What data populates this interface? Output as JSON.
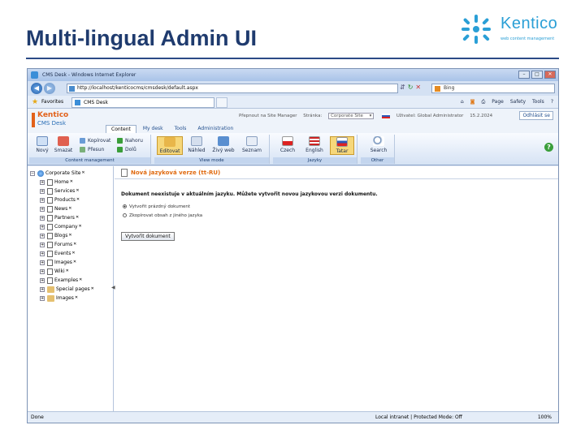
{
  "slide": {
    "title": "Multi-lingual Admin UI",
    "logo_name": "Kentico",
    "logo_tagline": "web content management"
  },
  "browser": {
    "window_title": "CMS Desk - Windows Internet Explorer",
    "address": "http://localhost/kenticocms/cmsdesk/default.aspx",
    "search_placeholder": "Bing",
    "favorites_label": "Favorites",
    "tab_label": "CMS Desk",
    "commands": [
      "Page",
      "Safety",
      "Tools"
    ],
    "status_left": "Done",
    "status_zone": "Local intranet | Protected Mode: Off",
    "zoom": "100%"
  },
  "cms": {
    "logo_kentico": "Kentico",
    "logo_desk": "CMS Desk",
    "header": {
      "switch_site_label": "Přepnout na Site Manager",
      "site_label": "Stránka:",
      "site_value": "Corporate Site",
      "user_label": "Uživatel: Global Administrator",
      "date": "15.2.2024",
      "logout": "Odhlásit se"
    },
    "tabs": [
      "Content",
      "My desk",
      "Tools",
      "Administration"
    ],
    "ribbon": {
      "content_management": {
        "label": "Content management",
        "new": "Nový",
        "delete": "Smazat",
        "copy": "Kopírovat",
        "move": "Přesun",
        "up": "Nahoru",
        "down": "Dolů"
      },
      "view_mode": {
        "label": "View mode",
        "edit": "Editovat",
        "preview": "Náhled",
        "live": "Živý web",
        "list": "Seznam"
      },
      "languages": {
        "label": "Jazyky",
        "czech": "Czech",
        "english": "English",
        "russian": "Tatar"
      },
      "other": {
        "label": "Other",
        "search": "Search"
      }
    },
    "tree": [
      {
        "label": "Corporate Site",
        "icon": "globe-icon"
      },
      {
        "label": "Home",
        "icon": "doc-icon"
      },
      {
        "label": "Services",
        "icon": "doc-icon"
      },
      {
        "label": "Products",
        "icon": "doc-icon"
      },
      {
        "label": "News",
        "icon": "doc-icon"
      },
      {
        "label": "Partners",
        "icon": "doc-icon"
      },
      {
        "label": "Company",
        "icon": "doc-icon"
      },
      {
        "label": "Blogs",
        "icon": "doc-icon"
      },
      {
        "label": "Forums",
        "icon": "doc-icon"
      },
      {
        "label": "Events",
        "icon": "doc-icon"
      },
      {
        "label": "Images",
        "icon": "doc-icon"
      },
      {
        "label": "Wiki",
        "icon": "doc-icon"
      },
      {
        "label": "Examples",
        "icon": "doc-icon"
      },
      {
        "label": "Special pages",
        "icon": "folder-icon"
      },
      {
        "label": "Images",
        "icon": "folder-icon"
      }
    ],
    "pane_title": "Nová jazyková verze (tt-RU)",
    "message": "Dokument neexistuje v aktuálním jazyku. Můžete vytvořit novou jazykovou verzi dokumentu.",
    "option_empty": "Vytvořit prázdný dokument",
    "option_copy": "Zkopírovat obsah z jiného jazyka",
    "create_button": "Vytvořit dokument"
  }
}
